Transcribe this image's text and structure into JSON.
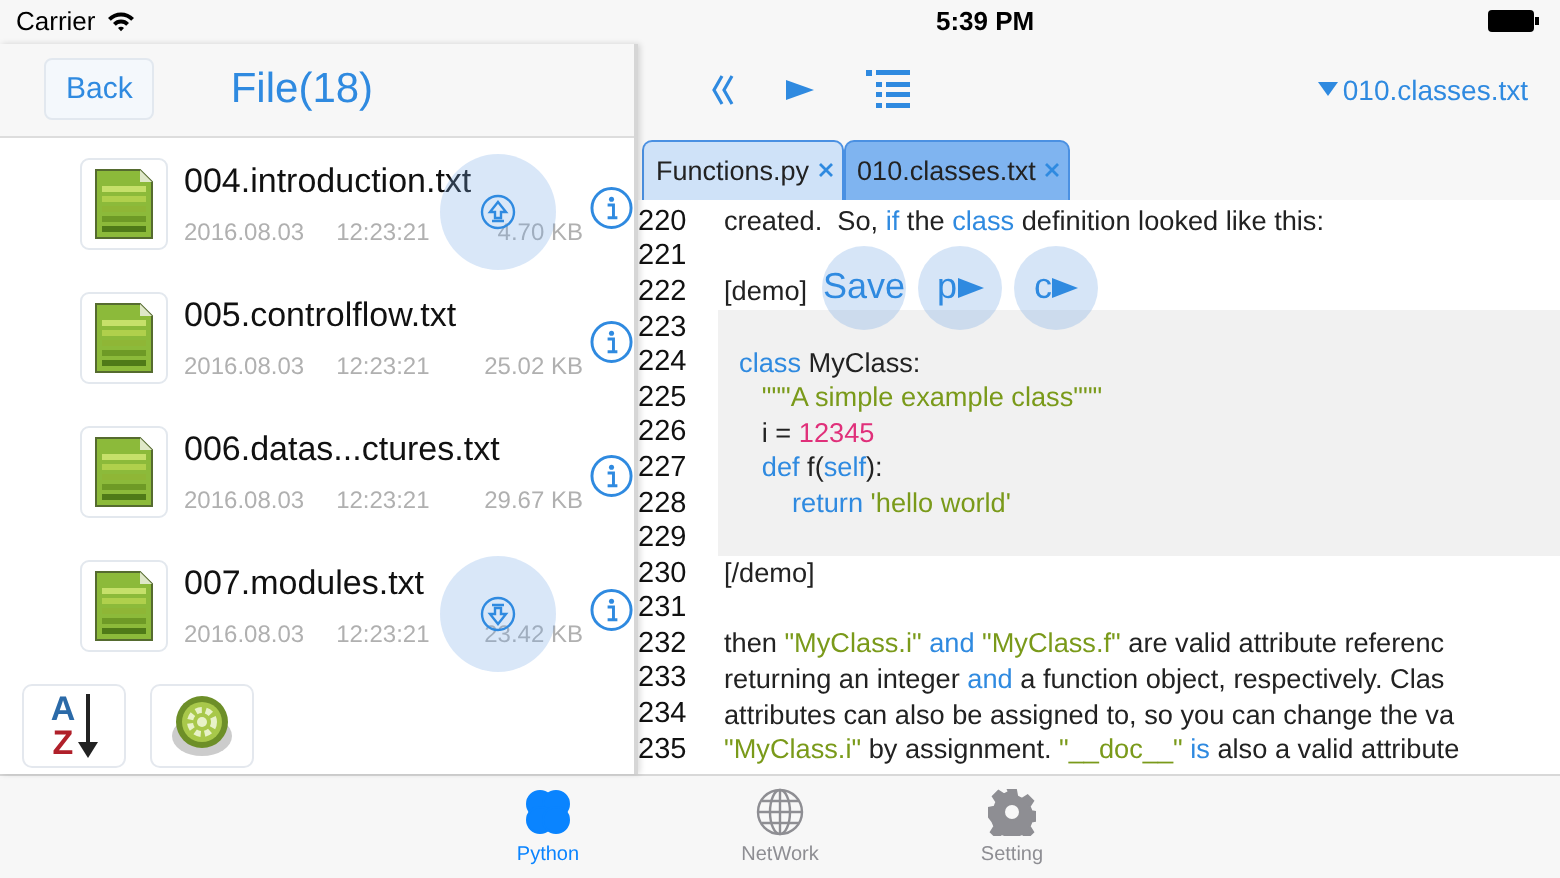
{
  "status_bar": {
    "carrier": "Carrier",
    "time": "5:39 PM"
  },
  "file_panel": {
    "back": "Back",
    "title": "File(18)",
    "files": [
      {
        "name": "004.introduction.txt",
        "date": "2016.08.03",
        "time": "12:23:21",
        "size": "4.70 KB",
        "float": {
          "kind": "up"
        }
      },
      {
        "name": "005.controlflow.txt",
        "date": "2016.08.03",
        "time": "12:23:21",
        "size": "25.02 KB"
      },
      {
        "name": "006.datas...ctures.txt",
        "date": "2016.08.03",
        "time": "12:23:21",
        "size": "29.67 KB"
      },
      {
        "name": "007.modules.txt",
        "date": "2016.08.03",
        "time": "12:23:21",
        "size": "23.42 KB",
        "float": {
          "kind": "down"
        }
      }
    ],
    "tools": [
      {
        "kind": "sort",
        "letters": [
          "A",
          "Z"
        ]
      },
      {
        "kind": "settings"
      }
    ]
  },
  "editor": {
    "current_file": "010.classes.txt",
    "tabs": [
      {
        "label": "Functions.py",
        "selected": false
      },
      {
        "label": "010.classes.txt",
        "selected": true
      }
    ],
    "float_buttons": [
      {
        "label": "Save",
        "play": false
      },
      {
        "label": "p",
        "play": true
      },
      {
        "label": "c",
        "play": true
      }
    ],
    "lines": [
      {
        "number": "220",
        "block": false,
        "segments": [
          {
            "kind": "plain",
            "text": "created.  So, "
          },
          {
            "kind": "keyword",
            "text": "if"
          },
          {
            "kind": "plain",
            "text": " the "
          },
          {
            "kind": "keyword",
            "text": "class"
          },
          {
            "kind": "plain",
            "text": " definition looked like this:"
          }
        ]
      },
      {
        "number": "221",
        "block": false
      },
      {
        "number": "222",
        "block": false,
        "segments": [
          {
            "kind": "plain",
            "text": "[demo]"
          }
        ]
      },
      {
        "number": "223",
        "block": true
      },
      {
        "number": "224",
        "block": true,
        "segments": [
          {
            "kind": "keyword",
            "text": "  class"
          },
          {
            "kind": "plain",
            "text": " MyClass:"
          }
        ]
      },
      {
        "number": "225",
        "block": true,
        "segments": [
          {
            "kind": "string",
            "text": "     \"\"\"A simple example class\"\"\""
          }
        ]
      },
      {
        "number": "226",
        "block": true,
        "segments": [
          {
            "kind": "plain",
            "text": "     i = "
          },
          {
            "kind": "number",
            "text": "12345"
          }
        ]
      },
      {
        "number": "227",
        "block": true,
        "segments": [
          {
            "kind": "keyword",
            "text": "     def"
          },
          {
            "kind": "plain",
            "text": " f("
          },
          {
            "kind": "keyword",
            "text": "self"
          },
          {
            "kind": "plain",
            "text": "):"
          }
        ]
      },
      {
        "number": "228",
        "block": true,
        "segments": [
          {
            "kind": "keyword",
            "text": "         return"
          },
          {
            "kind": "string",
            "text": " 'hello world'"
          }
        ]
      },
      {
        "number": "229",
        "block": true
      },
      {
        "number": "230",
        "block": false,
        "segments": [
          {
            "kind": "plain",
            "text": "[/demo]"
          }
        ]
      },
      {
        "number": "231",
        "block": false
      },
      {
        "number": "232",
        "block": false,
        "segments": [
          {
            "kind": "plain",
            "text": "then "
          },
          {
            "kind": "string",
            "text": "\"MyClass.i\""
          },
          {
            "kind": "keyword",
            "text": " and "
          },
          {
            "kind": "string",
            "text": "\"MyClass.f\""
          },
          {
            "kind": "plain",
            "text": " are valid attribute referenc"
          }
        ]
      },
      {
        "number": "233",
        "block": false,
        "segments": [
          {
            "kind": "plain",
            "text": "returning an integer "
          },
          {
            "kind": "keyword",
            "text": "and"
          },
          {
            "kind": "plain",
            "text": " a function object, respectively. Clas"
          }
        ]
      },
      {
        "number": "234",
        "block": false,
        "segments": [
          {
            "kind": "plain",
            "text": "attributes can also be assigned to, so you can change the va"
          }
        ]
      },
      {
        "number": "235",
        "block": false,
        "segments": [
          {
            "kind": "string",
            "text": "\"MyClass.i\""
          },
          {
            "kind": "plain",
            "text": " by assignment. "
          },
          {
            "kind": "string",
            "text": "\"__doc__\""
          },
          {
            "kind": "keyword",
            "text": " is"
          },
          {
            "kind": "plain",
            "text": " also a valid attribute"
          }
        ]
      }
    ]
  },
  "tab_bar": [
    {
      "label": "Python",
      "kind": "python",
      "selected": true
    },
    {
      "label": "NetWork",
      "kind": "globe",
      "selected": false
    },
    {
      "label": "Setting",
      "kind": "gear",
      "selected": false
    }
  ]
}
